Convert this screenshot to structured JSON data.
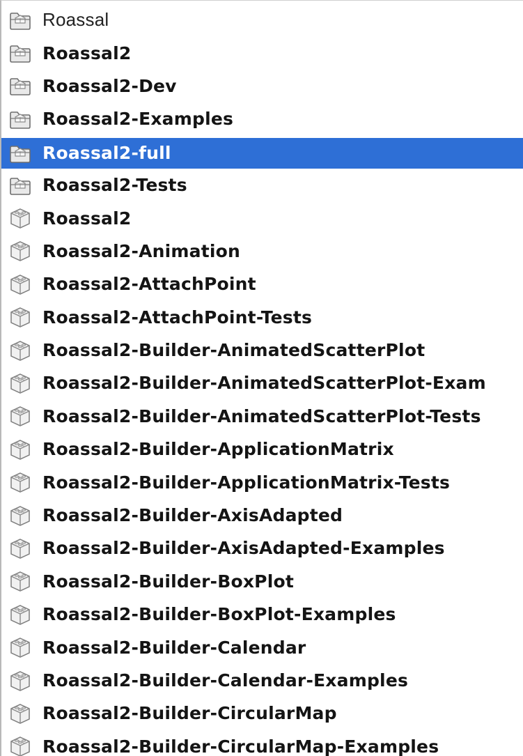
{
  "list": {
    "items": [
      {
        "label": "Roassal",
        "icon": "folder-package-icon",
        "bold": false,
        "selected": false
      },
      {
        "label": "Roassal2",
        "icon": "folder-package-icon",
        "bold": true,
        "selected": false
      },
      {
        "label": "Roassal2-Dev",
        "icon": "folder-package-icon",
        "bold": true,
        "selected": false
      },
      {
        "label": "Roassal2-Examples",
        "icon": "folder-package-icon",
        "bold": true,
        "selected": false
      },
      {
        "label": "Roassal2-full",
        "icon": "folder-package-icon",
        "bold": true,
        "selected": true
      },
      {
        "label": "Roassal2-Tests",
        "icon": "folder-package-icon",
        "bold": true,
        "selected": false
      },
      {
        "label": "Roassal2",
        "icon": "package-box-icon",
        "bold": true,
        "selected": false
      },
      {
        "label": "Roassal2-Animation",
        "icon": "package-box-icon",
        "bold": true,
        "selected": false
      },
      {
        "label": "Roassal2-AttachPoint",
        "icon": "package-box-icon",
        "bold": true,
        "selected": false
      },
      {
        "label": "Roassal2-AttachPoint-Tests",
        "icon": "package-box-icon",
        "bold": true,
        "selected": false
      },
      {
        "label": "Roassal2-Builder-AnimatedScatterPlot",
        "icon": "package-box-icon",
        "bold": true,
        "selected": false
      },
      {
        "label": "Roassal2-Builder-AnimatedScatterPlot-Exam",
        "icon": "package-box-icon",
        "bold": true,
        "selected": false
      },
      {
        "label": "Roassal2-Builder-AnimatedScatterPlot-Tests",
        "icon": "package-box-icon",
        "bold": true,
        "selected": false
      },
      {
        "label": "Roassal2-Builder-ApplicationMatrix",
        "icon": "package-box-icon",
        "bold": true,
        "selected": false
      },
      {
        "label": "Roassal2-Builder-ApplicationMatrix-Tests",
        "icon": "package-box-icon",
        "bold": true,
        "selected": false
      },
      {
        "label": "Roassal2-Builder-AxisAdapted",
        "icon": "package-box-icon",
        "bold": true,
        "selected": false
      },
      {
        "label": "Roassal2-Builder-AxisAdapted-Examples",
        "icon": "package-box-icon",
        "bold": true,
        "selected": false
      },
      {
        "label": "Roassal2-Builder-BoxPlot",
        "icon": "package-box-icon",
        "bold": true,
        "selected": false
      },
      {
        "label": "Roassal2-Builder-BoxPlot-Examples",
        "icon": "package-box-icon",
        "bold": true,
        "selected": false
      },
      {
        "label": "Roassal2-Builder-Calendar",
        "icon": "package-box-icon",
        "bold": true,
        "selected": false
      },
      {
        "label": "Roassal2-Builder-Calendar-Examples",
        "icon": "package-box-icon",
        "bold": true,
        "selected": false
      },
      {
        "label": "Roassal2-Builder-CircularMap",
        "icon": "package-box-icon",
        "bold": true,
        "selected": false
      },
      {
        "label": "Roassal2-Builder-CircularMap-Examples",
        "icon": "package-box-icon",
        "bold": true,
        "selected": false
      }
    ]
  },
  "colors": {
    "selection": "#2e6fd6",
    "text": "#141414",
    "selected_text": "#ffffff"
  }
}
